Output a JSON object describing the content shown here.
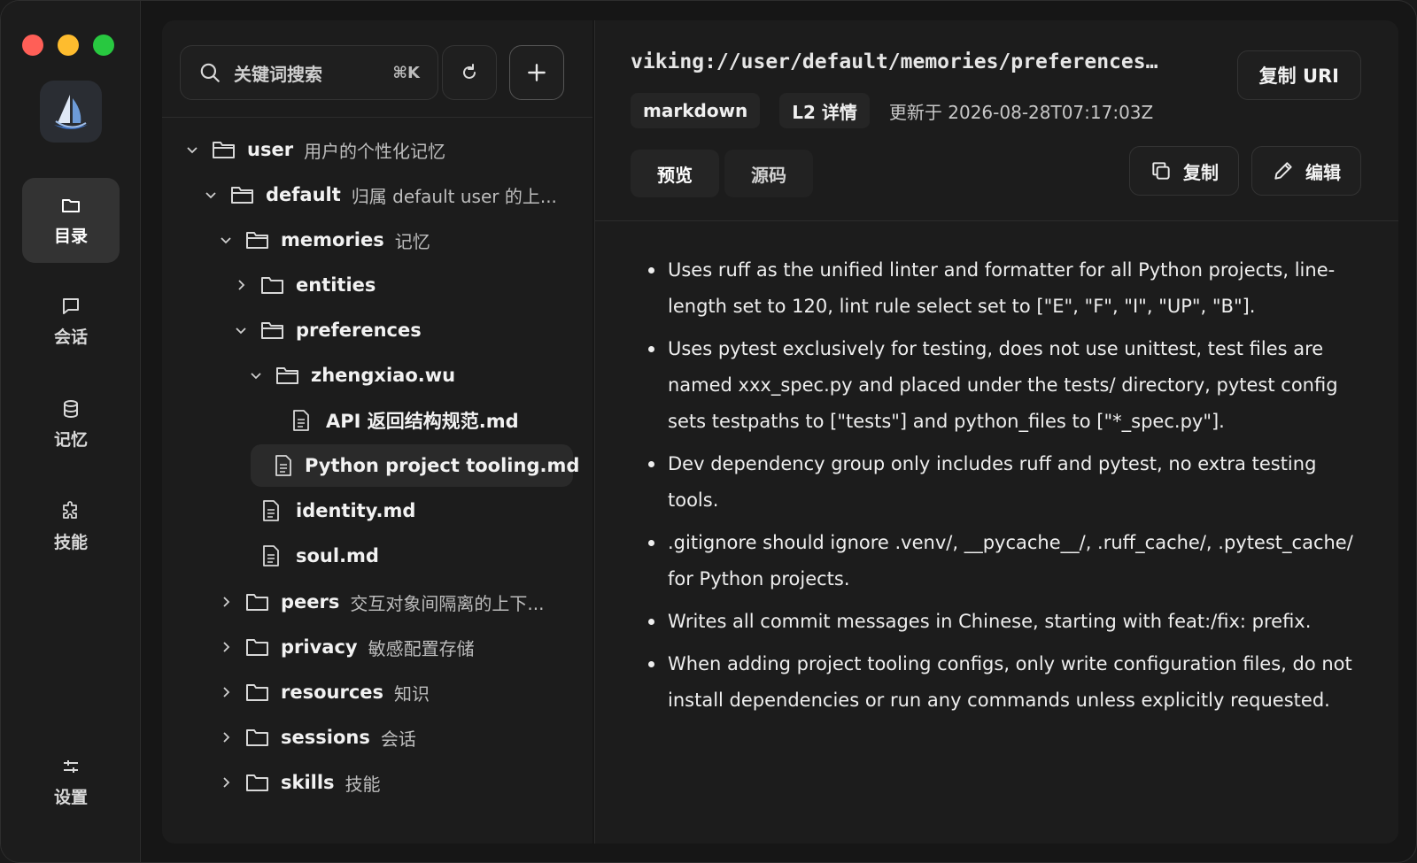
{
  "nav": {
    "items": [
      {
        "label": "目录",
        "icon": "folder-icon",
        "active": true
      },
      {
        "label": "会话",
        "icon": "chat-icon",
        "active": false
      },
      {
        "label": "记忆",
        "icon": "database-icon",
        "active": false
      },
      {
        "label": "技能",
        "icon": "puzzle-icon",
        "active": false
      }
    ],
    "settings_label": "设置"
  },
  "search": {
    "placeholder": "关键词搜索",
    "shortcut": "⌘K"
  },
  "tree": [
    {
      "name": "user",
      "desc": "用户的个性化记忆",
      "type": "folder",
      "expanded": true
    },
    {
      "name": "default",
      "desc": "归属 default user 的上...",
      "type": "folder",
      "expanded": true
    },
    {
      "name": "memories",
      "desc": "记忆",
      "type": "folder",
      "expanded": true
    },
    {
      "name": "entities",
      "desc": "",
      "type": "folder",
      "expanded": false
    },
    {
      "name": "preferences",
      "desc": "",
      "type": "folder",
      "expanded": true
    },
    {
      "name": "zhengxiao.wu",
      "desc": "",
      "type": "folder",
      "expanded": true
    },
    {
      "name": "API 返回结构规范.md",
      "desc": "",
      "type": "file"
    },
    {
      "name": "Python project tooling.md",
      "desc": "",
      "type": "file",
      "selected": true
    },
    {
      "name": "identity.md",
      "desc": "",
      "type": "file"
    },
    {
      "name": "soul.md",
      "desc": "",
      "type": "file"
    },
    {
      "name": "peers",
      "desc": "交互对象间隔离的上下...",
      "type": "folder",
      "expanded": false
    },
    {
      "name": "privacy",
      "desc": "敏感配置存储",
      "type": "folder",
      "expanded": false
    },
    {
      "name": "resources",
      "desc": "知识",
      "type": "folder",
      "expanded": false
    },
    {
      "name": "sessions",
      "desc": "会话",
      "type": "folder",
      "expanded": false
    },
    {
      "name": "skills",
      "desc": "技能",
      "type": "folder",
      "expanded": false
    }
  ],
  "doc": {
    "uri": "viking://user/default/memories/preferences…",
    "copy_uri_label": "复制 URI",
    "format": "markdown",
    "level": "L2 详情",
    "updated": "更新于 2026-08-28T07:17:03Z",
    "tabs": [
      "预览",
      "源码"
    ],
    "copy_label": "复制",
    "edit_label": "编辑",
    "bullets": [
      "Uses ruff as the unified linter and formatter for all Python projects, line-length set to 120, lint rule select set to [\"E\", \"F\", \"I\", \"UP\", \"B\"].",
      "Uses pytest exclusively for testing, does not use unittest, test files are named xxx_spec.py and placed under the tests/ directory, pytest config sets testpaths to [\"tests\"] and python_files to [\"*_spec.py\"].",
      "Dev dependency group only includes ruff and pytest, no extra testing tools.",
      ".gitignore should ignore .venv/, __pycache__/, .ruff_cache/, .pytest_cache/ for Python projects.",
      "Writes all commit messages in Chinese, starting with feat:/fix: prefix.",
      "When adding project tooling configs, only write configuration files, do not install dependencies or run any commands unless explicitly requested."
    ]
  }
}
